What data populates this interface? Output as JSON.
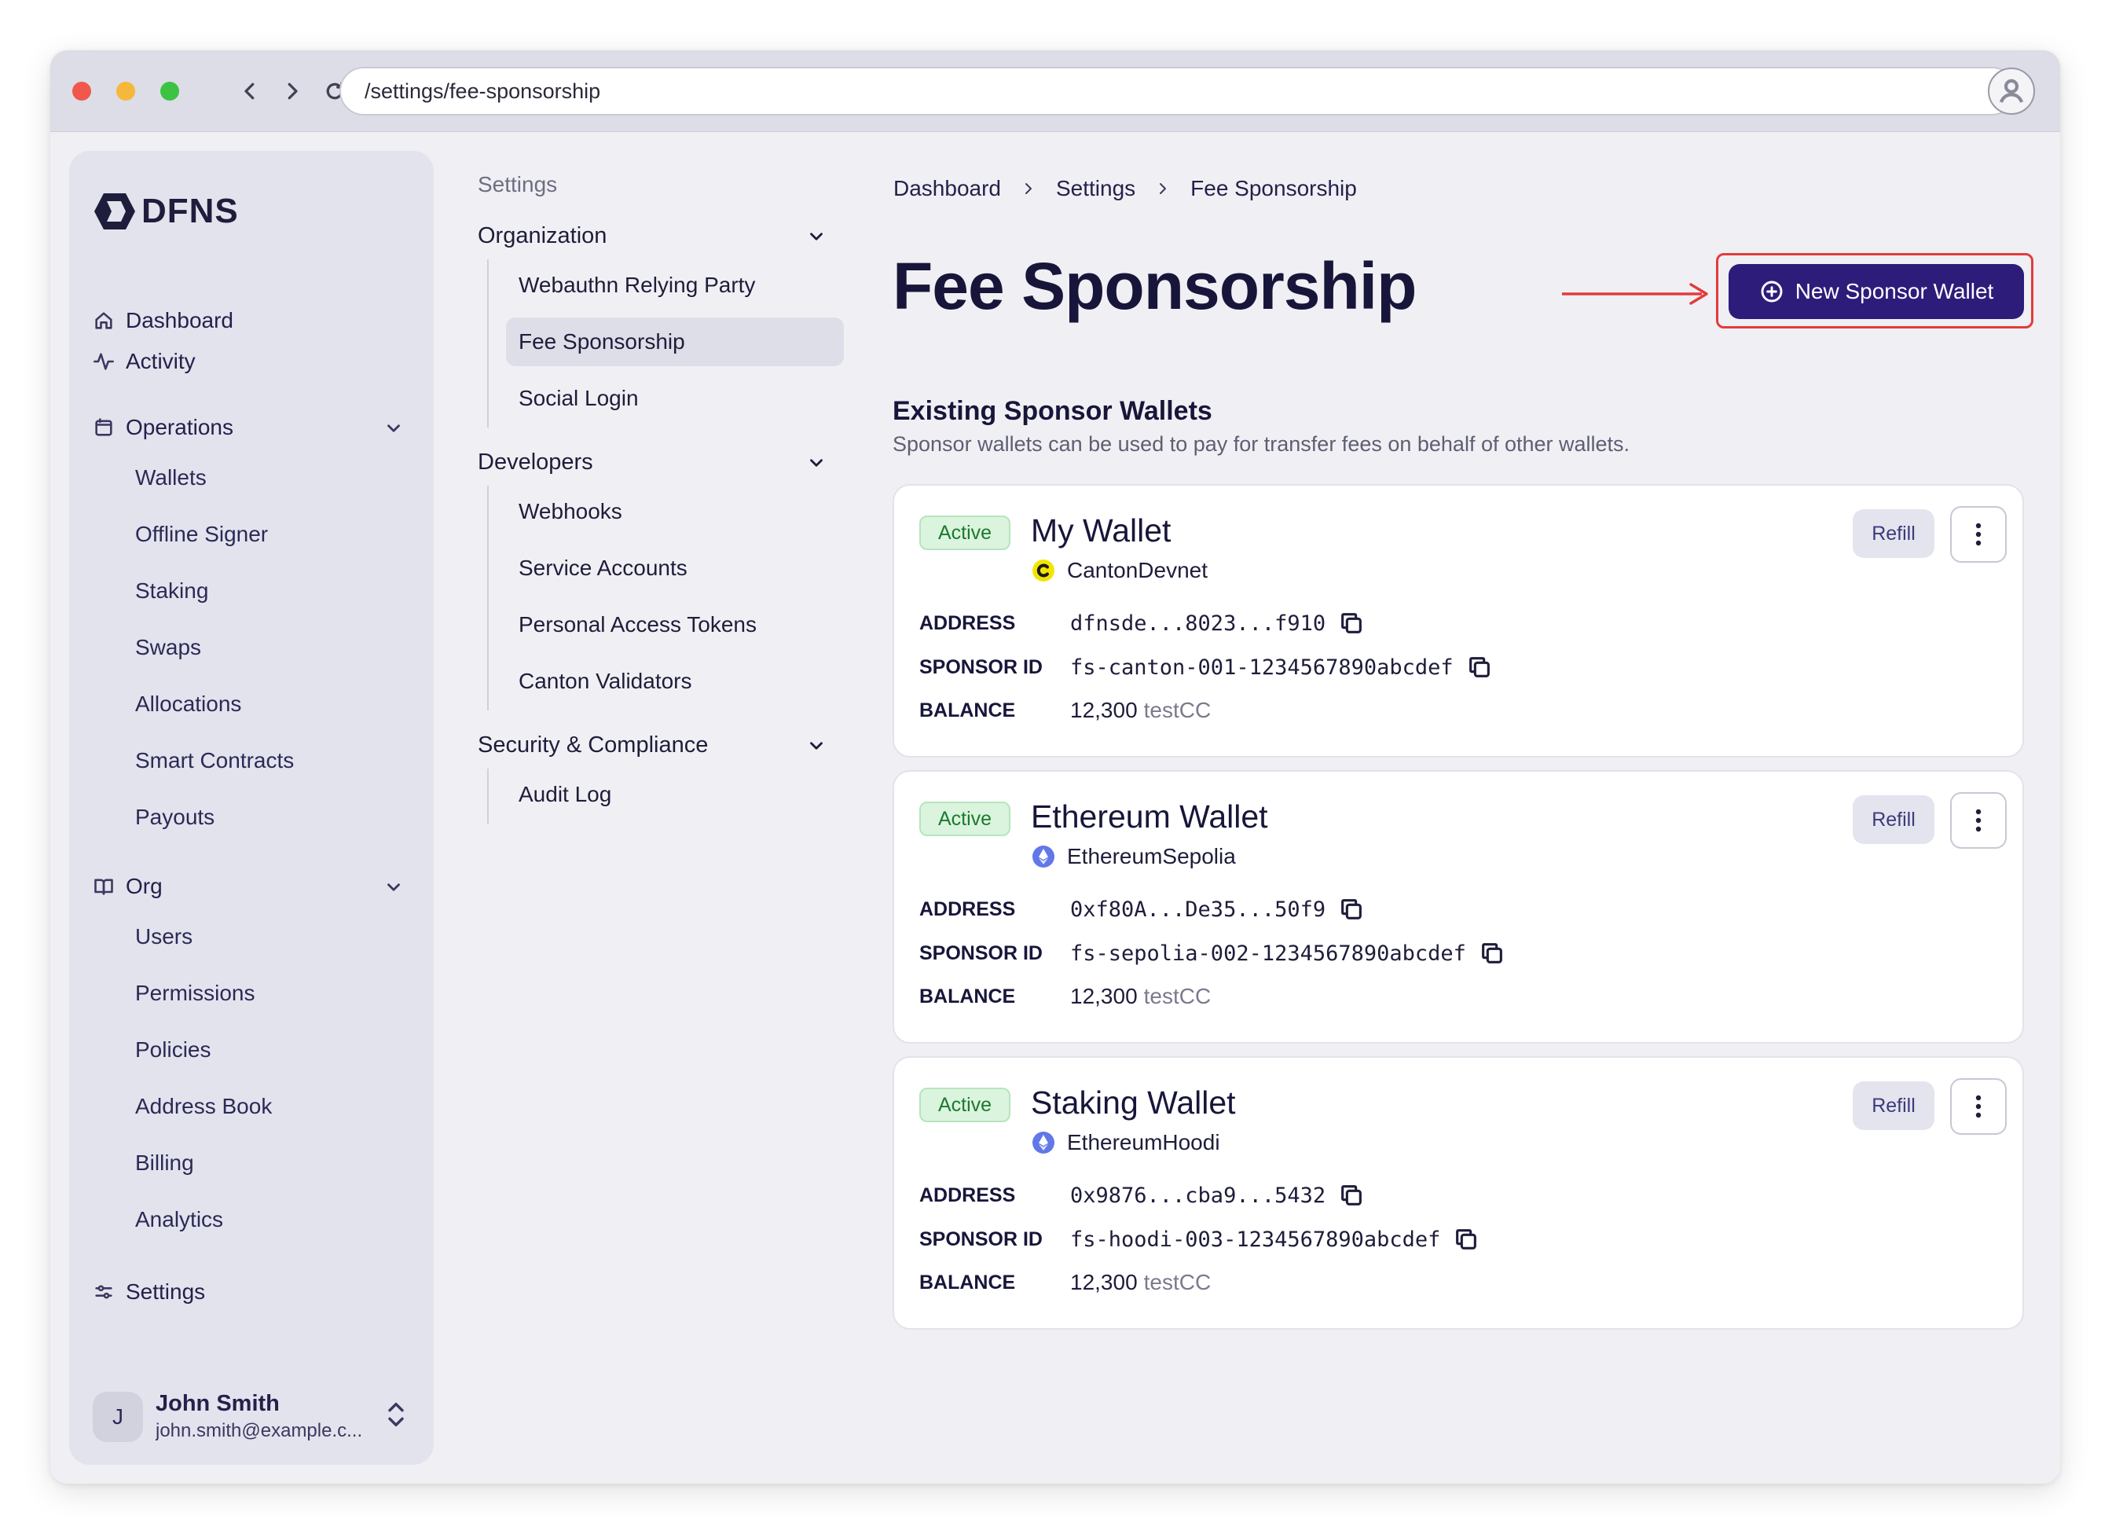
{
  "browser": {
    "url": "/settings/fee-sponsorship"
  },
  "sidebar": {
    "logo_text": "DFNS",
    "items": [
      {
        "label": "Dashboard",
        "icon": "home-icon"
      },
      {
        "label": "Activity",
        "icon": "activity-icon"
      },
      {
        "label": "Operations",
        "icon": "calendar-icon",
        "expanded": true
      },
      {
        "label": "Org",
        "icon": "book-icon",
        "expanded": true
      },
      {
        "label": "Settings",
        "icon": "sliders-icon"
      }
    ],
    "operations_items": [
      "Wallets",
      "Offline Signer",
      "Staking",
      "Swaps",
      "Allocations",
      "Smart Contracts",
      "Payouts"
    ],
    "org_items": [
      "Users",
      "Permissions",
      "Policies",
      "Address Book",
      "Billing",
      "Analytics"
    ],
    "user": {
      "initial": "J",
      "name": "John Smith",
      "email": "john.smith@example.c..."
    }
  },
  "settings_nav": {
    "title": "Settings",
    "groups": [
      {
        "label": "Organization",
        "items": [
          "Webauthn Relying Party",
          "Fee Sponsorship",
          "Social Login"
        ]
      },
      {
        "label": "Developers",
        "items": [
          "Webhooks",
          "Service Accounts",
          "Personal Access Tokens",
          "Canton Validators"
        ]
      },
      {
        "label": "Security & Compliance",
        "items": [
          "Audit Log"
        ]
      }
    ],
    "active_item": "Fee Sponsorship"
  },
  "breadcrumb": [
    "Dashboard",
    "Settings",
    "Fee Sponsorship"
  ],
  "page": {
    "title": "Fee Sponsorship",
    "new_button_label": "New Sponsor Wallet",
    "section_title": "Existing Sponsor Wallets",
    "section_desc": "Sponsor wallets can be used to pay for transfer fees on behalf of other wallets."
  },
  "field_labels": {
    "address": "ADDRESS",
    "sponsor_id": "SPONSOR ID",
    "balance": "BALANCE"
  },
  "wallets": [
    {
      "status": "Active",
      "name": "My Wallet",
      "network": "CantonDevnet",
      "network_icon": "canton-icon",
      "address": "dfnsde...8023...f910",
      "sponsor_id": "fs-canton-001-1234567890abcdef",
      "balance": "12,300",
      "unit": "testCC",
      "refill_label": "Refill"
    },
    {
      "status": "Active",
      "name": "Ethereum Wallet",
      "network": "EthereumSepolia",
      "network_icon": "ethereum-icon",
      "address": "0xf80A...De35...50f9",
      "sponsor_id": "fs-sepolia-002-1234567890abcdef",
      "balance": "12,300",
      "unit": "testCC",
      "refill_label": "Refill"
    },
    {
      "status": "Active",
      "name": "Staking Wallet",
      "network": "EthereumHoodi",
      "network_icon": "ethereum-icon",
      "address": "0x9876...cba9...5432",
      "sponsor_id": "fs-hoodi-003-1234567890abcdef",
      "balance": "12,300",
      "unit": "testCC",
      "refill_label": "Refill"
    }
  ],
  "colors": {
    "primary": "#2e1c7a",
    "highlight": "#e23c3c",
    "active_badge_bg": "#dbf4de",
    "active_badge_text": "#1c7a2e"
  }
}
